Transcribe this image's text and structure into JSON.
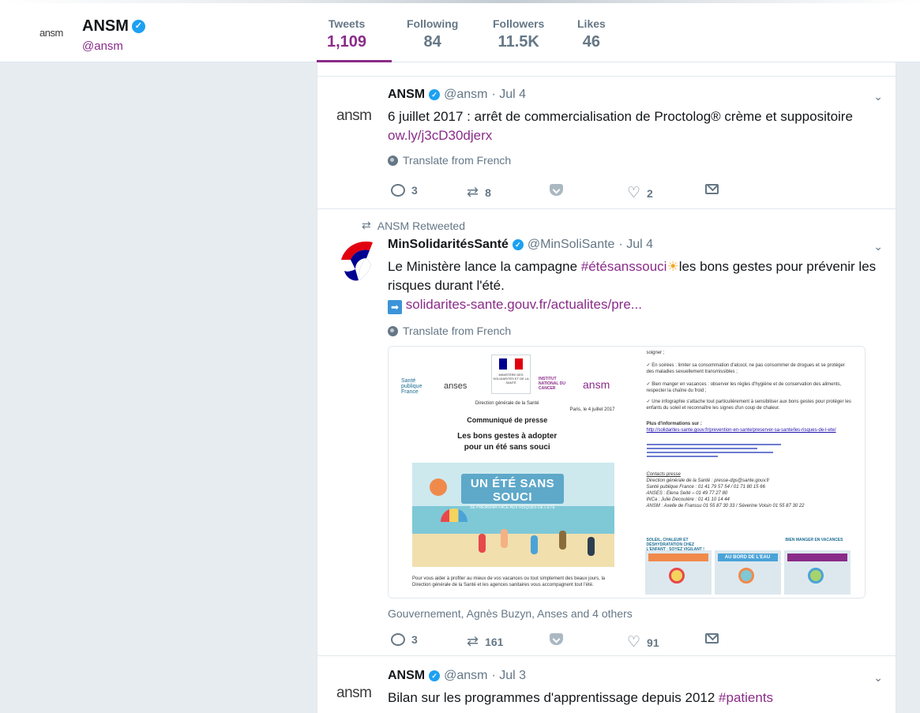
{
  "profile": {
    "logo_text": "ansm",
    "name": "ANSM",
    "handle": "@ansm"
  },
  "stats": [
    {
      "label": "Tweets",
      "value": "1,109"
    },
    {
      "label": "Following",
      "value": "84"
    },
    {
      "label": "Followers",
      "value": "11.5K"
    },
    {
      "label": "Likes",
      "value": "46"
    }
  ],
  "colors": {
    "accent": "#8a2c89",
    "verified": "#1da1f2",
    "muted": "#657786",
    "background": "#e6ecf0"
  },
  "tweets": [
    {
      "avatar_text": "ansm",
      "name": "ANSM",
      "handle": "@ansm",
      "date": "· Jul 4",
      "text": "6 juillet 2017 : arrêt de commercialisation de Proctolog® crème et suppositoire",
      "link": "ow.ly/j3cD30djerx",
      "translate": "Translate from French",
      "replies": "3",
      "retweets": "8",
      "likes": "2"
    },
    {
      "context": "ANSM Retweeted",
      "name": "MinSolidaritésSanté",
      "handle": "@MinSoliSante",
      "date": "· Jul 4",
      "text_before": "Le Ministère lance la campagne ",
      "hashtag": "#étésanssouci",
      "emoji": "☀",
      "text_after": "les bons gestes pour prévenir les risques durant l'été.",
      "arrow_icon": "➡",
      "link": "solidarites-sante.gouv.fr/actualites/pre...",
      "translate": "Translate from French",
      "media": {
        "left_doc": {
          "logo_santepublique": "Santé publique France",
          "logo_anses": "anses",
          "logo_ministere": "MINISTÈRE DES SOLIDARITÉS ET DE LA SANTÉ",
          "logo_inca": "INSTITUT NATIONAL DU CANCER",
          "logo_ansm": "ansm",
          "direction": "Direction générale de la Santé",
          "date_line": "Paris, le 4 juillet 2017",
          "title1": "Communiqué de presse",
          "title2": "Les bons gestes à adopter",
          "title3": "pour un été sans souci",
          "poster_title": "UN ÉTÉ SANS SOUCI",
          "poster_sub": "SE PRÉMUNIR FACE AUX RISQUES DE L'ÉTÉ",
          "body1": "Pour vous aider à profiter au mieux de vos vacances ou tout simplement des beaux jours, la Direction générale de la Santé et les agences sanitaires vous accompagnent tout l'été."
        },
        "right_doc": {
          "line_soigner": "soigner ;",
          "bullet1": "En soirées : limiter sa consommation d'alcool, ne pas consommer de drogues et se protéger des maladies sexuellement transmissibles ;",
          "bullet2": "Bien manger en vacances : observer les règles d'hygiène et de conservation des aliments, respecter la chaîne du froid ;",
          "bullet3": "Une infographie s'attache tout particulièrement à sensibiliser aux bons gestes pour protéger les enfants du soleil et reconnaître les signes d'un coup de chaleur.",
          "more_info": "Plus d'informations sur :",
          "link1": "http://solidarites-sante.gouv.fr/prevention-en-sante/preserver-sa-sante/les-risques-de-l-ete/",
          "contacts": "Contacts presse",
          "contact1": "Direction générale de la Santé : presse-dgs@sante.gouv.fr",
          "contact2": "Santé publique France : 01 41 79 57 54 / 01 71 80 15 66",
          "contact3": "ANSES : Elena Seité – 01 49 77 27 80",
          "contact4": "INCa : Julie Decoutère : 01 41 10 14 44",
          "contact5": "ANSM : Axelle de Franssu 01 55 87 30 33 / Séverine Voisin 01 55 87 30 22",
          "thumb1": "SOLEIL, CHALEUR ET DÉSHYDRATATION CHEZ L'ENFANT : SOYEZ VIGILANT !",
          "thumb2": "AU BORD DE L'EAU",
          "thumb3": "BIEN MANGER EN VACANCES"
        }
      },
      "caption": "Gouvernement, Agnès Buzyn, Anses and 4 others",
      "replies": "3",
      "retweets": "161",
      "likes": "91"
    },
    {
      "avatar_text": "ansm",
      "name": "ANSM",
      "handle": "@ansm",
      "date": "· Jul 3",
      "text_before": "Bilan sur les programmes d'apprentissage depuis 2012 ",
      "hashtag": "#patients"
    }
  ]
}
